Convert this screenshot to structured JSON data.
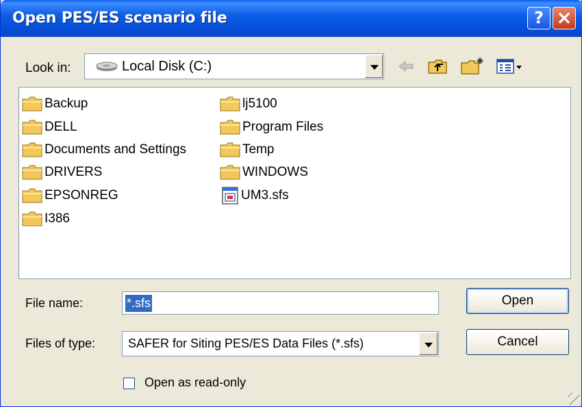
{
  "window": {
    "title": "Open PES/ES scenario file",
    "help_glyph": "?",
    "close_glyph": "×"
  },
  "toolbar": {
    "look_in_label": "Look in:",
    "look_in_value": "Local Disk (C:)",
    "look_in_icon": "hard-drive-icon",
    "icons": [
      "back-arrow-icon",
      "up-folder-icon",
      "new-folder-icon",
      "view-menu-icon"
    ]
  },
  "files": {
    "column1": [
      {
        "name": "Backup",
        "icon": "folder-icon"
      },
      {
        "name": "DELL",
        "icon": "folder-icon"
      },
      {
        "name": "Documents and Settings",
        "icon": "folder-icon"
      },
      {
        "name": "DRIVERS",
        "icon": "folder-icon"
      },
      {
        "name": "EPSONREG",
        "icon": "folder-icon"
      },
      {
        "name": "I386",
        "icon": "folder-icon"
      }
    ],
    "column2": [
      {
        "name": "lj5100",
        "icon": "folder-icon"
      },
      {
        "name": "Program Files",
        "icon": "folder-icon"
      },
      {
        "name": "Temp",
        "icon": "folder-icon"
      },
      {
        "name": "WINDOWS",
        "icon": "folder-icon"
      },
      {
        "name": "UM3.sfs",
        "icon": "sfs-file-icon"
      }
    ]
  },
  "form": {
    "file_name_label": "File name:",
    "file_name_value": "*.sfs",
    "files_of_type_label": "Files of type:",
    "files_of_type_value": "SAFER for Siting PES/ES Data Files (*.sfs)",
    "read_only_label": "Open as read-only",
    "read_only_checked": false
  },
  "buttons": {
    "open": "Open",
    "cancel": "Cancel"
  },
  "colors": {
    "title_bar": "#0550dc",
    "selection": "#316ac5",
    "dialog_bg": "#ece9d8",
    "folder": "#f3c85a"
  }
}
